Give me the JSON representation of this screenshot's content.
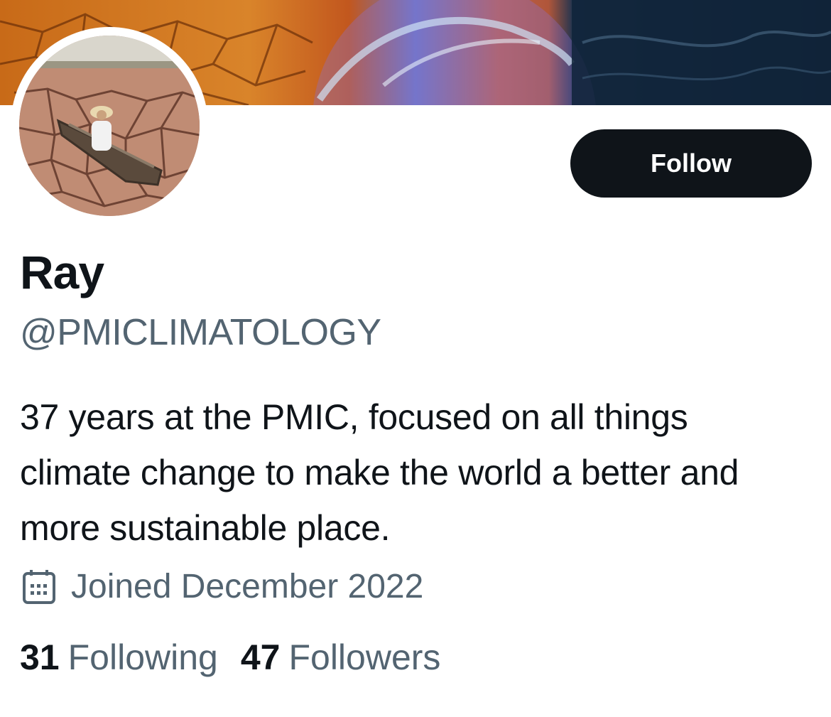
{
  "profile": {
    "name": "Ray",
    "handle": "@PMICLIMATOLOGY",
    "bio": "37 years at the PMIC, focused on all things climate change to make the world a better and more sustainable place.",
    "joined": "Joined December 2022",
    "following_count": "31",
    "following_label": "Following",
    "followers_count": "47",
    "followers_label": "Followers"
  },
  "actions": {
    "follow_label": "Follow"
  },
  "icons": {
    "joined": "calendar-icon"
  },
  "colors": {
    "text_primary": "#0f1419",
    "text_secondary": "#536471",
    "button_bg": "#0f1419",
    "button_text": "#ffffff"
  }
}
